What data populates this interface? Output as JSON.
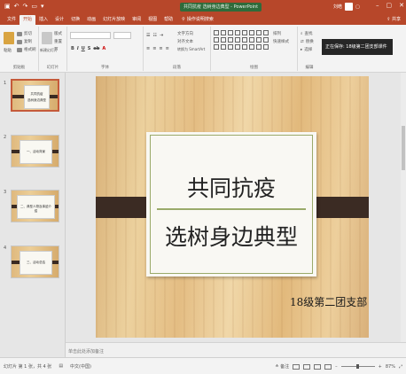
{
  "titlebar": {
    "doc_title": "共同抗疫 选树身边典型 - PowerPoint",
    "user": "刘皓",
    "quick_access": [
      "save-icon",
      "undo-icon",
      "redo-icon",
      "start-icon",
      "customize-icon"
    ]
  },
  "tabs": [
    "文件",
    "开始",
    "插入",
    "设计",
    "切换",
    "动画",
    "幻灯片放映",
    "审阅",
    "视图",
    "帮助"
  ],
  "active_tab": "开始",
  "tell_me": "操作说明搜索",
  "share_label": "共享",
  "ribbon": {
    "groups": [
      "剪贴板",
      "幻灯片",
      "字体",
      "段落",
      "绘图",
      "编辑"
    ],
    "clipboard": {
      "paste": "粘贴",
      "cut": "剪切",
      "copy": "复制",
      "format_painter": "格式刷"
    },
    "slides": {
      "new_slide": "新建幻灯片",
      "layout": "版式",
      "reset": "重置",
      "section": "节"
    },
    "paragraph": {
      "text_direction": "文字方向",
      "align_text": "对齐文本",
      "smartart": "转换为 SmartArt"
    },
    "drawing": {
      "arrange": "排列",
      "quick_styles": "快速样式"
    },
    "editing": {
      "find": "查找",
      "replace": "替换",
      "select": "选择"
    },
    "tooltip": "正在保存: 18级第二团支部课件"
  },
  "slides": [
    {
      "num": "1",
      "lines": [
        "共同抗疫",
        "选树身边典型"
      ],
      "selected": true
    },
    {
      "num": "2",
      "lines": [
        "一、活动背景"
      ],
      "selected": false
    },
    {
      "num": "3",
      "lines": [
        "二、典型人物及事迹介绍"
      ],
      "selected": false
    },
    {
      "num": "4",
      "lines": [
        "三、活动总结"
      ],
      "selected": false
    }
  ],
  "main_slide": {
    "title_line1": "共同抗疫",
    "title_line2": "选树身边典型",
    "subtitle": "18级第二团支部"
  },
  "notes_placeholder": "单击此处添加备注",
  "status": {
    "slide_info": "幻灯片 第 1 张，共 4 张",
    "language": "中文(中国)",
    "notes_button": "备注",
    "zoom": "87%"
  },
  "colors": {
    "accent": "#b7472a",
    "band": "#3b2b23",
    "frame": "#9aaa6a"
  }
}
